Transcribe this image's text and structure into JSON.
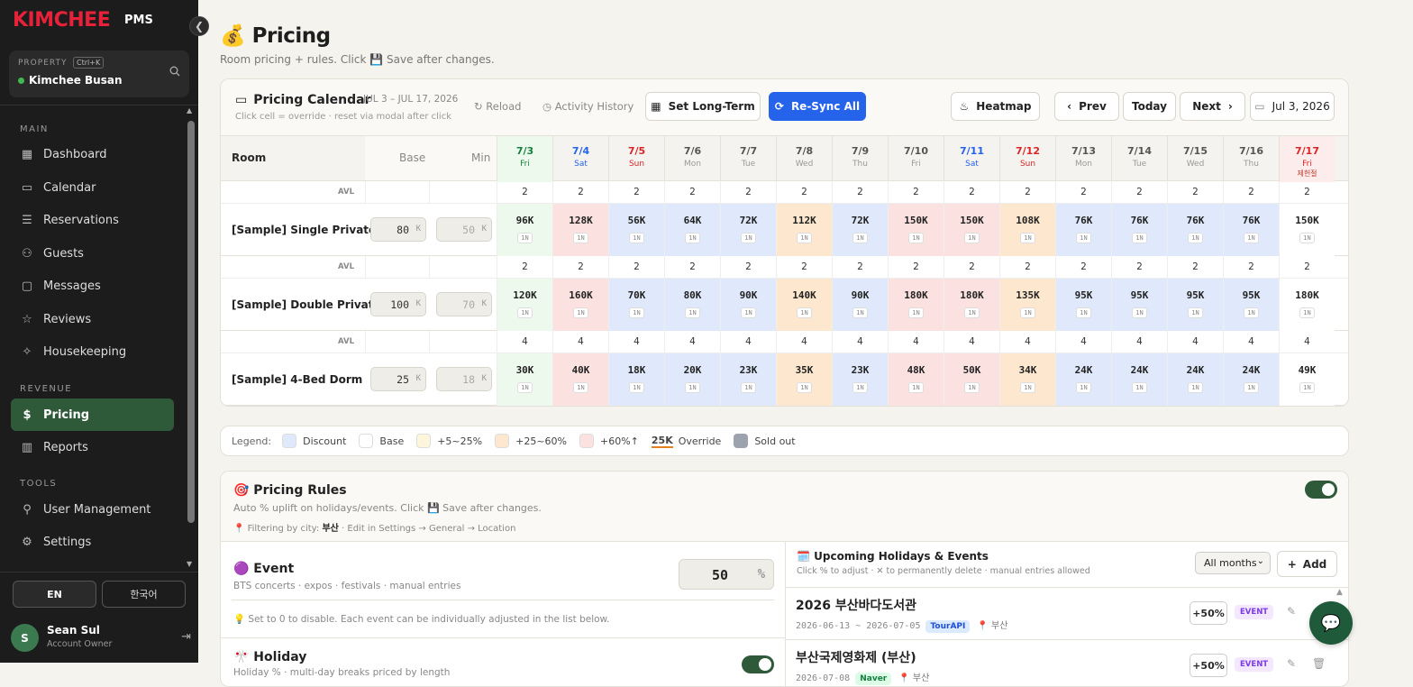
{
  "sidebar": {
    "logo": "KIMCHEE",
    "logo_sub": "PMS",
    "collapse_icon": "chevron-left-icon",
    "property": {
      "label": "PROPERTY",
      "shortcut": "Ctrl+K",
      "name": "Kimchee Busan"
    },
    "sections": {
      "main": "MAIN",
      "revenue": "REVENUE",
      "tools": "TOOLS"
    },
    "items": [
      {
        "label": "Dashboard",
        "icon": "grid-icon"
      },
      {
        "label": "Calendar",
        "icon": "calendar-icon"
      },
      {
        "label": "Reservations",
        "icon": "clipboard-icon"
      },
      {
        "label": "Guests",
        "icon": "users-icon"
      },
      {
        "label": "Messages",
        "icon": "message-icon"
      },
      {
        "label": "Reviews",
        "icon": "star-icon"
      },
      {
        "label": "Housekeeping",
        "icon": "sparkle-icon"
      },
      {
        "label": "Pricing",
        "icon": "dollar-icon"
      },
      {
        "label": "Reports",
        "icon": "bar-chart-icon"
      },
      {
        "label": "User Management",
        "icon": "user-key-icon"
      },
      {
        "label": "Settings",
        "icon": "gear-icon"
      }
    ],
    "lang": {
      "en": "EN",
      "ko": "한국어"
    },
    "user": {
      "initial": "S",
      "name": "Sean Sul",
      "role": "Account Owner"
    }
  },
  "page": {
    "title": "💰 Pricing",
    "subtitle": "Room pricing + rules. Click 💾 Save after changes."
  },
  "calendar": {
    "title": "Pricing Calendar",
    "range": "JUL 3 – JUL 17, 2026",
    "hint": "Click cell = override · reset via modal after click",
    "reload": "Reload",
    "activity": "Activity History",
    "set_long_term": "Set Long-Term",
    "resync": "Re-Sync All",
    "heatmap": "Heatmap",
    "prev": "Prev",
    "today": "Today",
    "next": "Next",
    "date": "Jul 3, 2026",
    "col_room": "Room",
    "col_base": "Base",
    "col_min": "Min",
    "avl_label": "AVL",
    "k": "K",
    "nights": "1N",
    "days": [
      {
        "d": "7/3",
        "w": "Fri",
        "kind": "today"
      },
      {
        "d": "7/4",
        "w": "Sat",
        "kind": "sat"
      },
      {
        "d": "7/5",
        "w": "Sun",
        "kind": "sun"
      },
      {
        "d": "7/6",
        "w": "Mon",
        "kind": ""
      },
      {
        "d": "7/7",
        "w": "Tue",
        "kind": ""
      },
      {
        "d": "7/8",
        "w": "Wed",
        "kind": ""
      },
      {
        "d": "7/9",
        "w": "Thu",
        "kind": ""
      },
      {
        "d": "7/10",
        "w": "Fri",
        "kind": ""
      },
      {
        "d": "7/11",
        "w": "Sat",
        "kind": "sat"
      },
      {
        "d": "7/12",
        "w": "Sun",
        "kind": "sun"
      },
      {
        "d": "7/13",
        "w": "Mon",
        "kind": ""
      },
      {
        "d": "7/14",
        "w": "Tue",
        "kind": ""
      },
      {
        "d": "7/15",
        "w": "Wed",
        "kind": ""
      },
      {
        "d": "7/16",
        "w": "Thu",
        "kind": ""
      },
      {
        "d": "7/17",
        "w": "Fri",
        "kind": "hol",
        "holiday": "제헌절"
      }
    ],
    "tiers": [
      "today",
      "p60",
      "disc",
      "disc",
      "disc",
      "p25",
      "disc",
      "p60",
      "p60",
      "p25",
      "disc",
      "disc",
      "disc",
      "disc",
      "base"
    ],
    "rooms": [
      {
        "name": "[Sample] Single Private",
        "base": "80",
        "min": "50",
        "avl": [
          "2",
          "2",
          "2",
          "2",
          "2",
          "2",
          "2",
          "2",
          "2",
          "2",
          "2",
          "2",
          "2",
          "2",
          "2"
        ],
        "prices": [
          "96K",
          "128K",
          "56K",
          "64K",
          "72K",
          "112K",
          "72K",
          "150K",
          "150K",
          "108K",
          "76K",
          "76K",
          "76K",
          "76K",
          "150K"
        ]
      },
      {
        "name": "[Sample] Double Private",
        "base": "100",
        "min": "70",
        "avl": [
          "2",
          "2",
          "2",
          "2",
          "2",
          "2",
          "2",
          "2",
          "2",
          "2",
          "2",
          "2",
          "2",
          "2",
          "2"
        ],
        "prices": [
          "120K",
          "160K",
          "70K",
          "80K",
          "90K",
          "140K",
          "90K",
          "180K",
          "180K",
          "135K",
          "95K",
          "95K",
          "95K",
          "95K",
          "180K"
        ]
      },
      {
        "name": "[Sample] 4-Bed Dorm",
        "base": "25",
        "min": "18",
        "avl": [
          "4",
          "4",
          "4",
          "4",
          "4",
          "4",
          "4",
          "4",
          "4",
          "4",
          "4",
          "4",
          "4",
          "4",
          "4"
        ],
        "prices": [
          "30K",
          "40K",
          "18K",
          "20K",
          "23K",
          "35K",
          "23K",
          "48K",
          "50K",
          "34K",
          "24K",
          "24K",
          "24K",
          "24K",
          "49K"
        ]
      }
    ]
  },
  "legend": {
    "label": "Legend:",
    "items": [
      {
        "label": "Discount",
        "color": "#dfe9fb"
      },
      {
        "label": "Base",
        "color": "#ffffff"
      },
      {
        "label": "+5~25%",
        "color": "#fdf6dd"
      },
      {
        "label": "+25~60%",
        "color": "#fde8cf"
      },
      {
        "label": "+60%↑",
        "color": "#fce1e1"
      }
    ],
    "override_sample": "25K",
    "override": "Override",
    "sold_out": "Sold out",
    "sold_out_color": "#9ca3af"
  },
  "rules": {
    "title": "🎯 Pricing Rules",
    "subtitle": "Auto % uplift on holidays/events. Click 💾 Save after changes.",
    "filter_prefix": "📍 Filtering by city:",
    "filter_city": "부산",
    "filter_suffix": "· Edit in Settings → General → Location",
    "event_title": "🟣 Event",
    "event_sub": "BTS concerts · expos · festivals · manual entries",
    "event_value": "50",
    "pct": "%",
    "tip": "💡 Set to 0 to disable. Each event can be individually adjusted in the list below.",
    "holiday_title": "🎌 Holiday",
    "holiday_sub": "Holiday % · multi-day breaks priced by length",
    "upcoming_title": "🗓️ Upcoming Holidays & Events",
    "upcoming_sub": "Click % to adjust · ✕ to permanently delete · manual entries allowed",
    "month_select": "All months",
    "add": "Add",
    "events": [
      {
        "name": "2026 부산바다도서관",
        "date": "2026-06-13 ~ 2026-07-05",
        "source": "TourAPI",
        "city": "부산",
        "pct": "+50%",
        "tag": "EVENT"
      },
      {
        "name": "부산국제영화제 (부산)",
        "date": "2026-07-08",
        "source": "Naver",
        "city": "부산",
        "pct": "+50%",
        "tag": "EVENT"
      }
    ]
  }
}
